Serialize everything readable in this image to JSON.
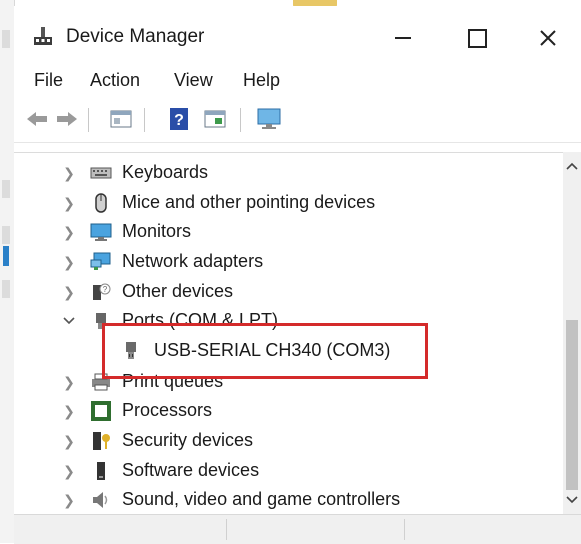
{
  "window": {
    "title": "Device Manager",
    "controls": {
      "minimize": "—",
      "maximize": "☐",
      "close": "✕"
    }
  },
  "menu": [
    {
      "label": "File"
    },
    {
      "label": "Action"
    },
    {
      "label": "View"
    },
    {
      "label": "Help"
    }
  ],
  "toolbar": {
    "buttons": [
      "back-icon",
      "forward-icon",
      "properties-icon",
      "help-icon",
      "update-driver-icon",
      "monitor-scan-icon"
    ]
  },
  "tree": {
    "rows": [
      {
        "label": "Keyboards",
        "icon": "keyboard-icon",
        "expanded": false
      },
      {
        "label": "Mice and other pointing devices",
        "icon": "mouse-icon",
        "expanded": false
      },
      {
        "label": "Monitors",
        "icon": "monitor-icon",
        "expanded": false
      },
      {
        "label": "Network adapters",
        "icon": "network-icon",
        "expanded": false
      },
      {
        "label": "Other devices",
        "icon": "other-devices-icon",
        "expanded": false
      },
      {
        "label": "Ports (COM & LPT)",
        "icon": "port-icon",
        "expanded": true
      },
      {
        "label": "USB-SERIAL CH340 (COM3)",
        "icon": "usb-serial-icon",
        "child": true
      },
      {
        "label": "Print queues",
        "icon": "printer-icon",
        "expanded": false
      },
      {
        "label": "Processors",
        "icon": "processor-icon",
        "expanded": false
      },
      {
        "label": "Security devices",
        "icon": "security-icon",
        "expanded": false
      },
      {
        "label": "Software devices",
        "icon": "software-icon",
        "expanded": false
      },
      {
        "label": "Sound, video and game controllers",
        "icon": "sound-icon",
        "expanded": false
      }
    ]
  },
  "colors": {
    "highlight_box": "#d42a2a",
    "accent_blue": "#2a80c8"
  }
}
